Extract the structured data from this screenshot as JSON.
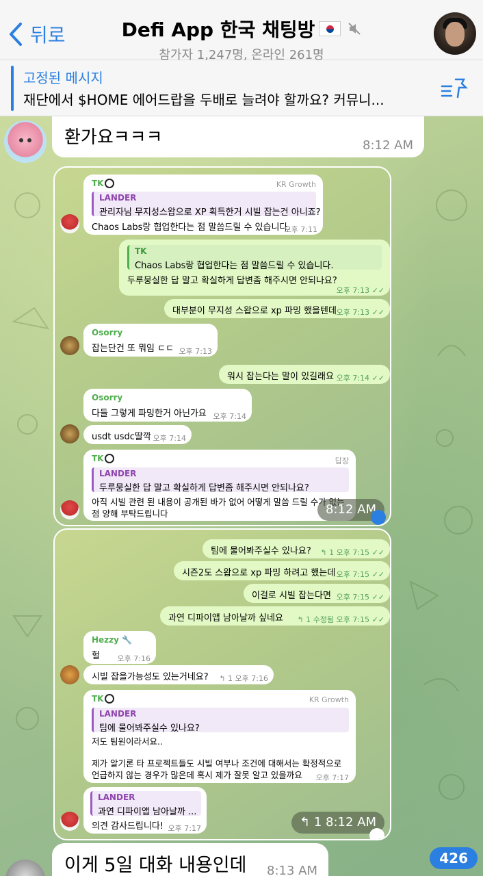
{
  "header": {
    "back_label": "뒤로",
    "title": "Defi App 한국 채팅방",
    "subtitle": "참가자 1,247명, 온라인 261명"
  },
  "pinned": {
    "title": "고정된 메시지",
    "text": "재단에서 $HOME 에어드랍을 두배로 늘려야 할까요? 커뮤니..."
  },
  "top_message": {
    "text": "환가요ㅋㅋㅋ",
    "time": "8:12 AM"
  },
  "shot1": {
    "m1": {
      "sender": "TK",
      "tag": "KR Growth",
      "quote_name": "LANDER",
      "quote_text": "관리자님 무지성스왑으로 XP 획득한거 시빌 잡는건 아니죠?",
      "text": "Chaos Labs랑 협업한다는 점 말씀드릴 수 있습니다.",
      "time": "오후 7:11"
    },
    "m2": {
      "quote_name": "TK",
      "quote_text": "Chaos Labs랑 협업한다는 점 말씀드릴 수 있습니다.",
      "text": "두루뭉실한 답 말고 확실하게 답변좀 해주시면 안되나요?",
      "time": "오후 7:13"
    },
    "m3": {
      "text": "대부분이 무지성 스왑으로 xp 파밍 했을텐데",
      "time": "오후 7:13"
    },
    "m4": {
      "sender": "Osorry",
      "text": "잡는단건 또 뭐임 ㄷㄷ",
      "time": "오후 7:13"
    },
    "m5": {
      "text": "워시 잡는다는 말이 있길래요",
      "time": "오후 7:14"
    },
    "m6": {
      "sender": "Osorry",
      "text": "다들 그렇게 파밍한거 아닌가요",
      "time": "오후 7:14"
    },
    "m7": {
      "text": "usdt usdc딸깍",
      "time": "오후 7:14"
    },
    "m8": {
      "sender": "TK",
      "tag": "답장",
      "quote_name": "LANDER",
      "quote_text": "두루뭉실한 답 말고 확실하게 답변좀 해주시면 안되나요?",
      "line1": "아직 시빌 관련 된 내용이 공개된 바가 없어 어떻게 말씀 드릴 수가 없는",
      "line2": "점 양해 부탁드립니다"
    },
    "overlay_time": "8:12 AM"
  },
  "shot2": {
    "m1": {
      "text": "팀에 물어봐주실수 있나요?",
      "reply": "1",
      "time": "오후 7:15"
    },
    "m2": {
      "text": "시즌2도 스왑으로 xp 파밍 하려고 했는데",
      "time": "오후 7:15"
    },
    "m3": {
      "text": "이걸로 시빌 잡는다면",
      "time": "오후 7:15"
    },
    "m4": {
      "text": "과연 디파이앱 남아날까 싶네요",
      "reply": "1",
      "edited": "수정됨",
      "time": "오후 7:15"
    },
    "m5": {
      "sender": "Hezzy",
      "text": "헐",
      "time": "오후 7:16"
    },
    "m6": {
      "text": "시빌 잡을가능성도 있는거네요?",
      "reply": "1",
      "time": "오후 7:16"
    },
    "m7": {
      "sender": "TK",
      "tag": "KR Growth",
      "quote_name": "LANDER",
      "quote_text": "팀에 물어봐주실수 있나요?",
      "line1": "저도 팀원이라서요..",
      "line2": "제가 알기론 타 프로젝트들도 시빌 여부나 조건에 대해서는 확정적으로",
      "line3": "언급하지 않는 경우가 많은데 혹시 제가 잘못 알고 있을까요",
      "time": "오후 7:17"
    },
    "m8": {
      "quote_name": "LANDER",
      "quote_text": "과연 디파이앱 남아날까 ...",
      "text": "의견 감사드립니다!",
      "time": "오후 7:17"
    },
    "overlay_reply": "1",
    "overlay_time": "8:12 AM"
  },
  "bottom_message": {
    "text": "이게 5일 대화 내용인데",
    "time": "8:13 AM"
  },
  "unread_badge": "426",
  "colors": {
    "accent": "#2b7fe0",
    "outgoing_bubble": "#e2f9c5",
    "quote_purple": "#8e44ad",
    "sender_green": "#4fae4e"
  }
}
